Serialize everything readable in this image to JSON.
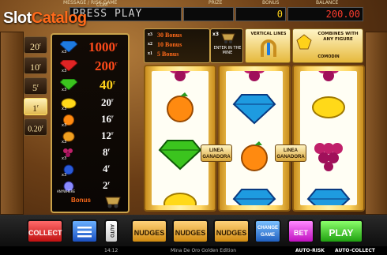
{
  "header": {
    "labels": [
      "MESSAGE / RISK GAME",
      "PRIZE",
      "BONUS",
      "BALANCE"
    ],
    "com_label": "COM",
    "message": "PRESS PLAY",
    "prize": "",
    "bonus": "0",
    "balance": "200.00"
  },
  "logo": {
    "part1": "Slot",
    "part2": "Catalog"
  },
  "bets": [
    {
      "label": "20",
      "active": false
    },
    {
      "label": "10",
      "active": false
    },
    {
      "label": "5",
      "active": false
    },
    {
      "label": "1",
      "active": true
    },
    {
      "label": "0.20",
      "active": false
    }
  ],
  "paytable": [
    {
      "icon": "blue-diamond-icon",
      "mult": "x3",
      "value": "1000",
      "color": "#ff4a1a"
    },
    {
      "icon": "red-diamond-icon",
      "mult": "x3",
      "value": "200",
      "color": "#ff4a1a"
    },
    {
      "icon": "green-diamond-icon",
      "mult": "x3",
      "value": "40",
      "color": "#ffd21a"
    },
    {
      "icon": "lemon-icon",
      "mult": "x3",
      "value": "20",
      "color": "#ffffff"
    },
    {
      "icon": "orange-icon",
      "mult": "x3",
      "value": "16",
      "color": "#ffffff"
    },
    {
      "icon": "plum-icon",
      "mult": "x3",
      "value": "12",
      "color": "#ffffff"
    },
    {
      "icon": "grapes-icon",
      "mult": "x3",
      "value": "8",
      "color": "#ffffff"
    },
    {
      "icon": "blue-orb-icon",
      "mult": "x3",
      "value": "4",
      "color": "#ffffff"
    },
    {
      "icon": "gem-icon",
      "mult": "ANYWHERE",
      "value": "2",
      "color": "#ffffff"
    }
  ],
  "paytable_unit": "r",
  "bonus_label": "Bonus",
  "bonus_panel": {
    "lines": [
      {
        "mult": "x3",
        "text": "30 Bonus"
      },
      {
        "mult": "x2",
        "text": "10 Bonus"
      },
      {
        "mult": "x1",
        "text": "5 Bonus"
      }
    ],
    "enter_text": "ENTER IN THE MINE",
    "enter_mult": "x3"
  },
  "lines_panel": {
    "title": "VERTICAL LINES"
  },
  "combines_panel": {
    "title": "COMBINES WITH ANY FIGURE",
    "badge": "COMODIN"
  },
  "linea_label": "LINEA GANADORA",
  "reels": [
    [
      "grapes-icon",
      "orange-icon",
      "green-diamond-icon",
      "lemon-icon"
    ],
    [
      "grapes-icon",
      "blue-diamond-icon",
      "orange-icon",
      "blue-diamond-icon"
    ],
    [
      "grapes-icon",
      "lemon-icon",
      "grapes-icon",
      "blue-diamond-icon"
    ]
  ],
  "buttons": {
    "collect": "COLLECT",
    "auto": "AUTO",
    "nudges": "NUDGES",
    "change_game": "CHANGE GAME",
    "bet": "BET",
    "play": "PLAY"
  },
  "footer": {
    "time": "14:12",
    "game_name": "Mina De Oro Golden Edition",
    "auto_risk": "AUTO-RISK",
    "auto_collect": "AUTO-COLLECT"
  }
}
